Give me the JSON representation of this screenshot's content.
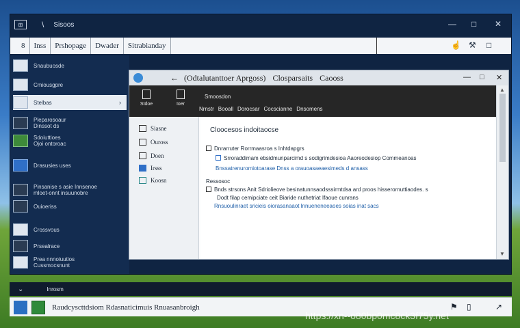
{
  "outer_window": {
    "logo_text": "⊞",
    "separator": "\\",
    "title": "Sisoos",
    "controls": {
      "minimize": "—",
      "maximize": "□",
      "close": "✕"
    }
  },
  "toolbar": {
    "items": [
      "8",
      "Inss",
      "Prshopage",
      "Dwader",
      "Sitrabianday"
    ],
    "icons": {
      "hand": "☝",
      "tools": "⚒",
      "window": "□"
    }
  },
  "sidebar": {
    "items": [
      {
        "label": "Snaubuosde",
        "icon": "panel-icon"
      },
      {
        "label": "Cmiousgpre",
        "icon": "panel-icon"
      },
      {
        "label": "Stelbas",
        "icon": "panel-icon",
        "active": true,
        "chevron": "›"
      },
      {
        "label": "Pleparosoaur\nDinssot ds",
        "icon": "panel-icon"
      },
      {
        "label": "Sdoiuttioes\nOjoi ontoroac",
        "icon": "green-icon"
      },
      {
        "label": "Drasusies uses",
        "icon": "blue-icon"
      },
      {
        "label": "Pinsanise s asie Innsenoe\nmloet-onnt insuunobre",
        "icon": "panel-icon"
      },
      {
        "label": "Ouioeriss",
        "icon": "panel-icon"
      },
      {
        "label": "Crossvous",
        "icon": "panel-icon"
      },
      {
        "label": "Prsealrace",
        "icon": "panel-icon"
      },
      {
        "label": "Prea nnnoiuutios\nCussmocsnunt",
        "icon": "panel-icon"
      }
    ]
  },
  "inner_window": {
    "back": "←",
    "title_1": "(Odtalutanttoer Aprgoss)",
    "title_2": "Closparsaits",
    "title_3": "Caooss",
    "controls": {
      "minimize": "—",
      "maximize": "□",
      "close": "✕"
    },
    "ribbon": {
      "button_1": "Stdoe",
      "button_2": "Ioer",
      "heading": "Smoosdon",
      "tabs": [
        "Nrnstr",
        "Booall",
        "Dorocsar",
        "Cocscianne",
        "Dnsomens"
      ]
    },
    "nav": [
      "Siasne",
      "Ouross",
      "Doen",
      "Irsss",
      "Koosn"
    ],
    "content": {
      "heading": "Cloocesos indoitaocse",
      "line_1": "Dnrarruter Rorrmaasroa s Inhtdapgrs",
      "line_2": "Srroraddimam ebsidmunparcimd s sodigrimdesioa Aaoreodesiop Commeanoas",
      "line_3": "Bnssatrenuromiotoarase Dnss a orauoasaeaesimeds d ansass",
      "section_label": "Ressosoc",
      "line_4": "Bnds strsons Anit Sdriolieove besinatunnsaodsssirmtdsa ard proos hisserornuttiaodes. s",
      "line_5": "Dodt filap cemipciate ceit Biaride nuthetriat Ifaoue cunrans",
      "line_6": "Rnsuoulinraet sricieis oiorasanaaot lnnueneneeaoes soias inat sacs"
    },
    "scroll": {
      "up": "▲",
      "down": "▼"
    }
  },
  "status_strip": {
    "icon": "⌄",
    "text": "Inrosm"
  },
  "taskbar": {
    "text": "Raudcyscttdsiom Rdasnaticimuis Rnuasanbroigh",
    "tray": {
      "flag": "⚑",
      "doc": "▯",
      "arrow": "↗"
    }
  },
  "watermark": "https://xn--o80bp0mc8ck3f75y.net"
}
